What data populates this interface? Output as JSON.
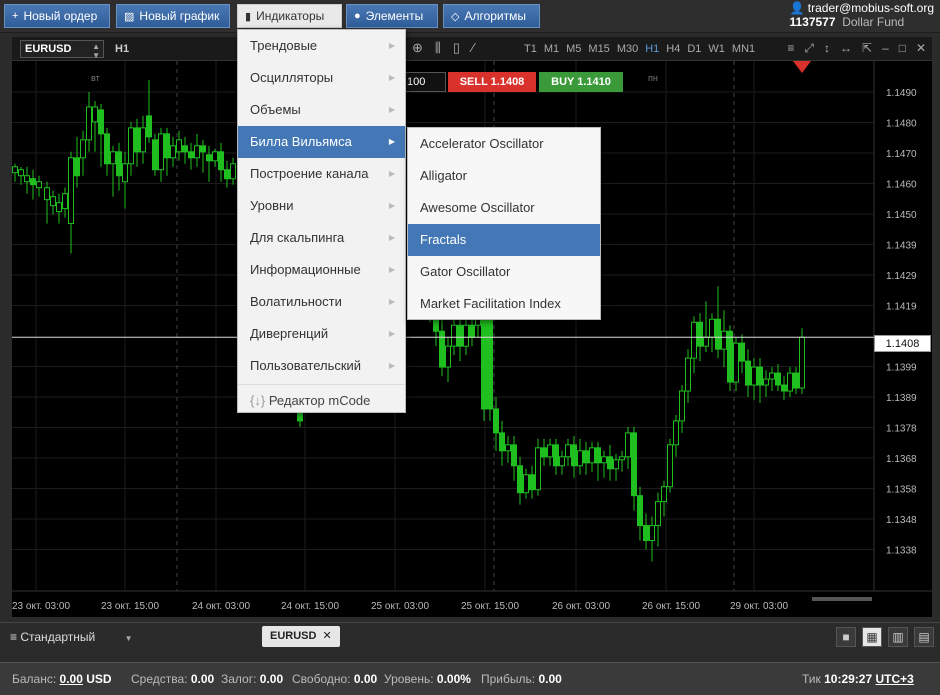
{
  "toolbar": {
    "new_order": "Новый ордер",
    "new_chart": "Новый график",
    "indicators": "Индикаторы",
    "elements": "Элементы",
    "algorithms": "Алгоритмы"
  },
  "account": {
    "user": "trader@mobius-soft.org",
    "id": "1137577",
    "fund": "Dollar Fund"
  },
  "chart_toolbar": {
    "symbol": "EURUSD",
    "timeframe": "H1",
    "timeframes": [
      "T1",
      "M1",
      "M5",
      "M15",
      "M30",
      "H1",
      "H4",
      "D1",
      "W1",
      "MN1"
    ],
    "active_timeframe": "H1"
  },
  "trade": {
    "qty": "100",
    "sell": "SELL 1.1408",
    "buy": "BUY 1.1410"
  },
  "indicators_menu": {
    "items": [
      {
        "label": "Трендовые"
      },
      {
        "label": "Осцилляторы"
      },
      {
        "label": "Объемы"
      },
      {
        "label": "Билла Вильямса"
      },
      {
        "label": "Построение канала"
      },
      {
        "label": "Уровни"
      },
      {
        "label": "Для скальпинга"
      },
      {
        "label": "Информационные"
      },
      {
        "label": "Волатильности"
      },
      {
        "label": "Дивергенций"
      },
      {
        "label": "Пользовательский"
      }
    ],
    "selected": "Билла Вильямса",
    "code_editor": "Редактор mCode"
  },
  "williams_submenu": {
    "items": [
      {
        "label": "Accelerator Oscillator"
      },
      {
        "label": "Alligator"
      },
      {
        "label": "Awesome Oscillator"
      },
      {
        "label": "Fractals"
      },
      {
        "label": "Gator Oscillator"
      },
      {
        "label": "Market Facilitation Index"
      }
    ],
    "selected": "Fractals"
  },
  "price_axis": [
    "1.1490",
    "1.1480",
    "1.1470",
    "1.1460",
    "1.1450",
    "1.1439",
    "1.1429",
    "1.1419",
    "1.1399",
    "1.1389",
    "1.1378",
    "1.1368",
    "1.1358",
    "1.1348",
    "1.1338"
  ],
  "current_price": "1.1408",
  "time_axis": [
    "23 окт. 03:00",
    "23 окт. 15:00",
    "24 окт. 03:00",
    "24 окт. 15:00",
    "25 окт. 03:00",
    "25 окт. 15:00",
    "26 окт. 03:00",
    "26 окт. 15:00",
    "29 окт. 03:00"
  ],
  "day_labels": [
    "вт",
    "пт",
    "пн"
  ],
  "bottom_tabs": {
    "layout": "Стандартный",
    "chart_tab": "EURUSD"
  },
  "status_bar": {
    "balance_label": "Баланс:",
    "balance": "0.00",
    "currency": "USD",
    "funds_label": "Средства:",
    "funds": "0.00",
    "margin_label": "Залог:",
    "margin": "0.00",
    "free_label": "Свободно:",
    "free": "0.00",
    "level_label": "Уровень:",
    "level": "0.00%",
    "profit_label": "Прибыль:",
    "profit": "0.00",
    "tick_label": "Тик",
    "time": "10:29:27",
    "timezone": "UTC+3"
  },
  "colors": {
    "up": "#1fbf1f",
    "sell": "#d9312c",
    "buy": "#3a9a3a",
    "accent": "#4377b5"
  }
}
